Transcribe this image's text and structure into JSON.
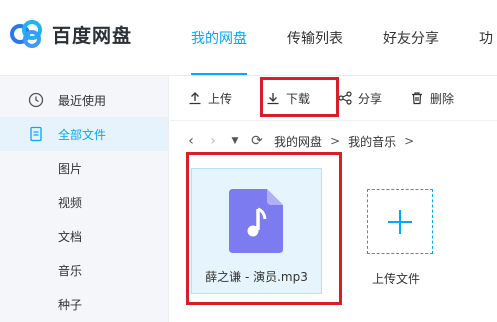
{
  "app": {
    "title": "百度网盘"
  },
  "nav": {
    "tabs": [
      {
        "label": "我的网盘",
        "active": true
      },
      {
        "label": "传输列表",
        "active": false
      },
      {
        "label": "好友分享",
        "active": false
      },
      {
        "label": "功",
        "active": false
      }
    ]
  },
  "sidebar": {
    "items": [
      {
        "label": "最近使用",
        "icon": "clock-icon",
        "active": false
      },
      {
        "label": "全部文件",
        "icon": "document-icon",
        "active": true
      },
      {
        "label": "图片",
        "active": false
      },
      {
        "label": "视频",
        "active": false
      },
      {
        "label": "文档",
        "active": false
      },
      {
        "label": "音乐",
        "active": false
      },
      {
        "label": "种子",
        "active": false
      }
    ]
  },
  "toolbar": {
    "upload_label": "上传",
    "download_label": "下载",
    "share_label": "分享",
    "delete_label": "删除"
  },
  "path": {
    "crumbs": [
      "我的网盘",
      "我的音乐"
    ],
    "separator": ">"
  },
  "files": [
    {
      "name": "薛之谦 - 演员.mp3",
      "icon": "music-file-icon"
    }
  ],
  "upload_tile": {
    "label": "上传文件"
  },
  "colors": {
    "accent": "#06a7ff",
    "highlight": "#d81e27",
    "file_icon": "#7c7bf0"
  }
}
